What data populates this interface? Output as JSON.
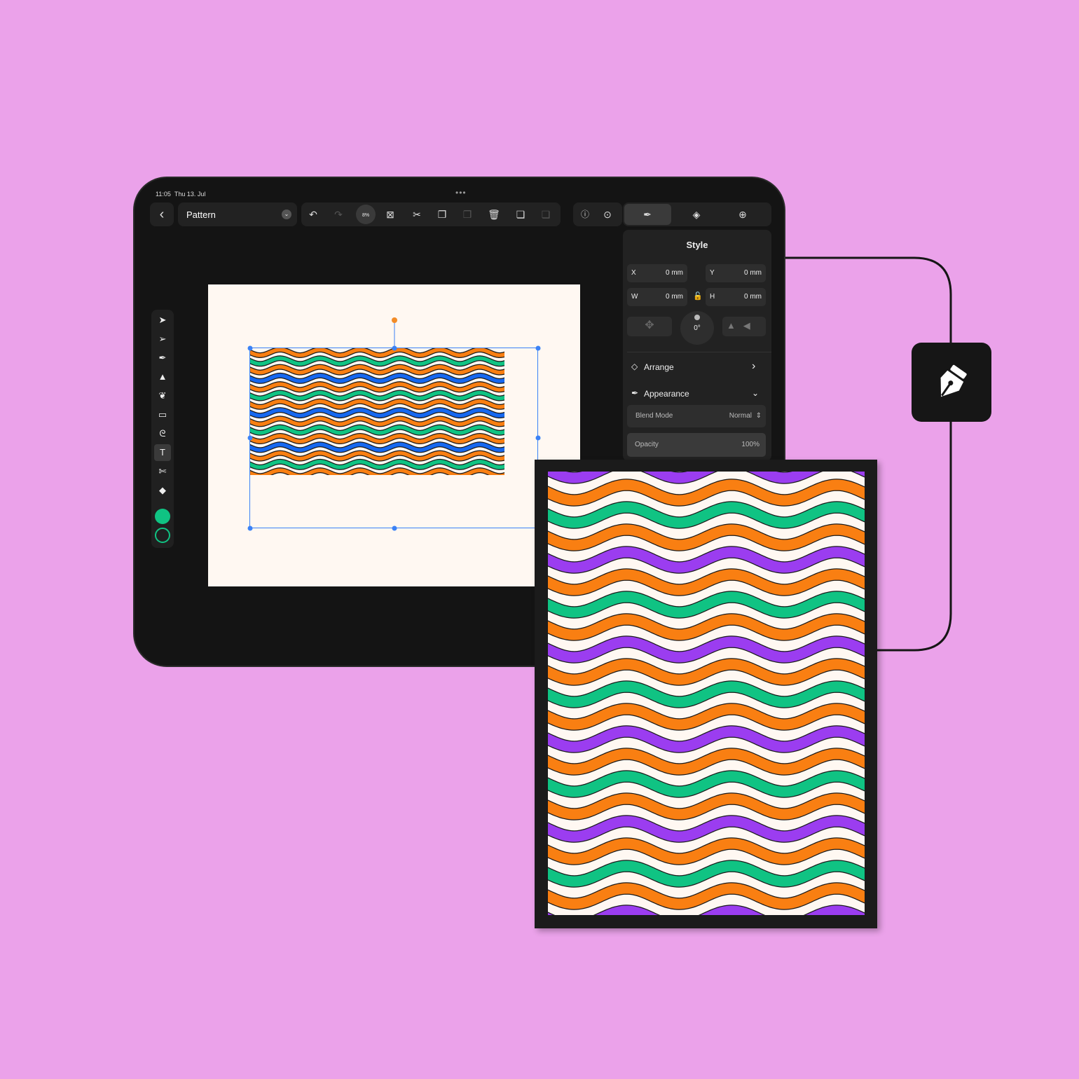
{
  "status_bar": {
    "time": "11:05",
    "date": "Thu 13. Jul",
    "more": "•••"
  },
  "toolbar": {
    "document_name": "Pattern",
    "zoom": "8%"
  },
  "panel": {
    "title": "Style",
    "x_label": "X",
    "x_value": "0 mm",
    "y_label": "Y",
    "y_value": "0 mm",
    "w_label": "W",
    "w_value": "0 mm",
    "h_label": "H",
    "h_value": "0 mm",
    "rotation": "0°",
    "arrange": "Arrange",
    "appearance": "Appearance",
    "blend_mode_label": "Blend Mode",
    "blend_mode_value": "Normal",
    "opacity_label": "Opacity",
    "opacity_value": "100%"
  },
  "colors": {
    "background": "#EBA2EA",
    "accent": "#3B82F6",
    "handle": "#F28C28",
    "fill": "#10C383",
    "stroke": "#10C383"
  },
  "canvas_pattern": [
    "#F97F12",
    "#10C383",
    "#F97F12",
    "#1668F0"
  ],
  "frame_pattern": [
    "#F97F12",
    "#10C383",
    "#F97F12",
    "#9B3DF0"
  ]
}
